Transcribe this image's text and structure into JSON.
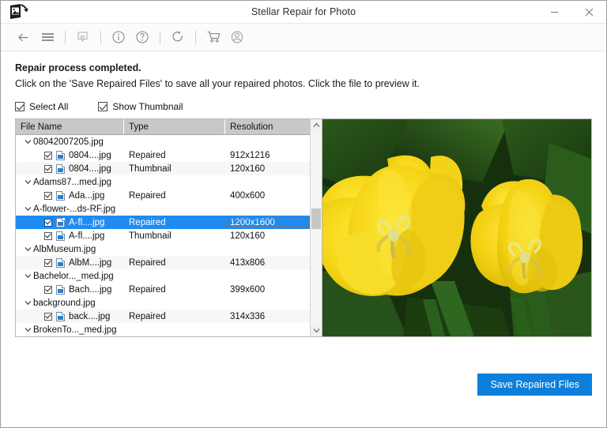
{
  "window": {
    "title": "Stellar Repair for Photo",
    "logo_icon": "photo-repair-logo-icon",
    "minimize_label": "–",
    "close_label": "✕"
  },
  "toolbar": {
    "items": [
      {
        "name": "back-icon",
        "glyph": "←"
      },
      {
        "name": "hamburger-menu-icon",
        "glyph": "☰"
      },
      {
        "name": "save-file-icon",
        "glyph": "ὋE"
      },
      {
        "name": "info-icon",
        "glyph": "i"
      },
      {
        "name": "help-icon",
        "glyph": "?"
      },
      {
        "name": "refresh-update-icon",
        "glyph": "↻"
      },
      {
        "name": "cart-icon",
        "glyph": "Ὥ2"
      },
      {
        "name": "user-account-icon",
        "glyph": "὆4"
      }
    ]
  },
  "messages": {
    "heading": "Repair process completed.",
    "subheading": "Click on the 'Save Repaired Files' to save all your repaired photos. Click the file to preview it."
  },
  "options": {
    "select_all_label": "Select All",
    "select_all_checked": true,
    "show_thumbnail_label": "Show Thumbnail",
    "show_thumbnail_checked": true
  },
  "table": {
    "columns": [
      "File Name",
      "Type",
      "Resolution"
    ],
    "rows": [
      {
        "kind": "group",
        "name": "08042007205.jpg",
        "expanded": true
      },
      {
        "kind": "file",
        "checked": true,
        "name": "0804....jpg",
        "type": "Repaired",
        "resolution": "912x1216",
        "selected": false
      },
      {
        "kind": "file",
        "checked": true,
        "name": "0804....jpg",
        "type": "Thumbnail",
        "resolution": "120x160",
        "selected": false
      },
      {
        "kind": "group",
        "name": "Adams87...med.jpg",
        "expanded": true
      },
      {
        "kind": "file",
        "checked": true,
        "name": "Ada...jpg",
        "type": "Repaired",
        "resolution": "400x600",
        "selected": false
      },
      {
        "kind": "group",
        "name": "A-flower-...ds-RF.jpg",
        "expanded": true
      },
      {
        "kind": "file",
        "checked": true,
        "name": "A-fl....jpg",
        "type": "Repaired",
        "resolution": "1200x1600",
        "selected": true
      },
      {
        "kind": "file",
        "checked": true,
        "name": "A-fl....jpg",
        "type": "Thumbnail",
        "resolution": "120x160",
        "selected": false
      },
      {
        "kind": "group",
        "name": "AlbMuseum.jpg",
        "expanded": true
      },
      {
        "kind": "file",
        "checked": true,
        "name": "AlbM....jpg",
        "type": "Repaired",
        "resolution": "413x806",
        "selected": false
      },
      {
        "kind": "group",
        "name": "Bachelor..._med.jpg",
        "expanded": true
      },
      {
        "kind": "file",
        "checked": true,
        "name": "Bach....jpg",
        "type": "Repaired",
        "resolution": "399x600",
        "selected": false
      },
      {
        "kind": "group",
        "name": "background.jpg",
        "expanded": true
      },
      {
        "kind": "file",
        "checked": true,
        "name": "back....jpg",
        "type": "Repaired",
        "resolution": "314x336",
        "selected": false
      },
      {
        "kind": "group",
        "name": "BrokenTo..._med.jpg",
        "expanded": true
      }
    ],
    "expand_glyph": "⌄",
    "scrollbar": {
      "up_glyph": "∧",
      "down_glyph": "∨"
    }
  },
  "preview": {
    "alt": "two-yellow-tulips-photo"
  },
  "footer": {
    "save_button_label": "Save Repaired Files"
  },
  "colors": {
    "accent": "#0d7fdb",
    "selection": "#1f8bf0",
    "header": "#c8c8c8"
  }
}
